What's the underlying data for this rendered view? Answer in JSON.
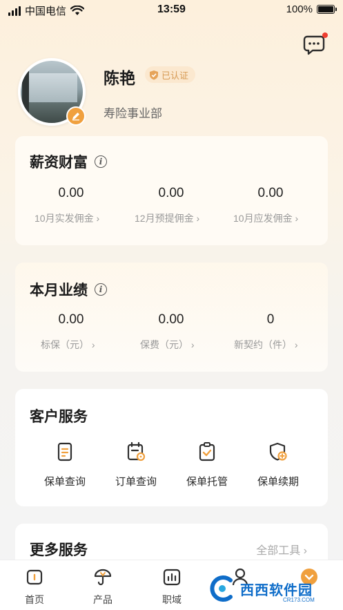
{
  "status_bar": {
    "carrier": "中国电信",
    "time": "13:59",
    "battery": "100%"
  },
  "profile": {
    "name": "陈艳",
    "verified_label": "已认证",
    "department": "寿险事业部"
  },
  "salary": {
    "title": "薪资财富",
    "stats": [
      {
        "value": "0.00",
        "label": "10月实发佣金"
      },
      {
        "value": "0.00",
        "label": "12月预提佣金"
      },
      {
        "value": "0.00",
        "label": "10月应发佣金"
      }
    ]
  },
  "performance": {
    "title": "本月业绩",
    "stats": [
      {
        "value": "0.00",
        "label": "标保（元）"
      },
      {
        "value": "0.00",
        "label": "保费（元）"
      },
      {
        "value": "0",
        "label": "新契约（件）"
      }
    ]
  },
  "customer_service": {
    "title": "客户服务",
    "items": [
      {
        "label": "保单查询",
        "icon": "policy-doc-icon"
      },
      {
        "label": "订单查询",
        "icon": "calendar-order-icon"
      },
      {
        "label": "保单托管",
        "icon": "clipboard-check-icon"
      },
      {
        "label": "保单续期",
        "icon": "shield-plus-icon"
      }
    ]
  },
  "more_services": {
    "title": "更多服务",
    "all_tools": "全部工具"
  },
  "tabbar": {
    "items": [
      {
        "label": "首页",
        "icon": "home-icon"
      },
      {
        "label": "产品",
        "icon": "umbrella-icon"
      },
      {
        "label": "职域",
        "icon": "chart-icon"
      },
      {
        "label": "",
        "icon": "person-icon"
      },
      {
        "label": "",
        "icon": "orange-badge-icon"
      }
    ]
  },
  "watermark": {
    "text": "西西软件园",
    "sub": "CR173.COM"
  },
  "colors": {
    "accent": "#f0a03e",
    "badge_red": "#ee3d2f",
    "verified_text": "#d79b55"
  }
}
